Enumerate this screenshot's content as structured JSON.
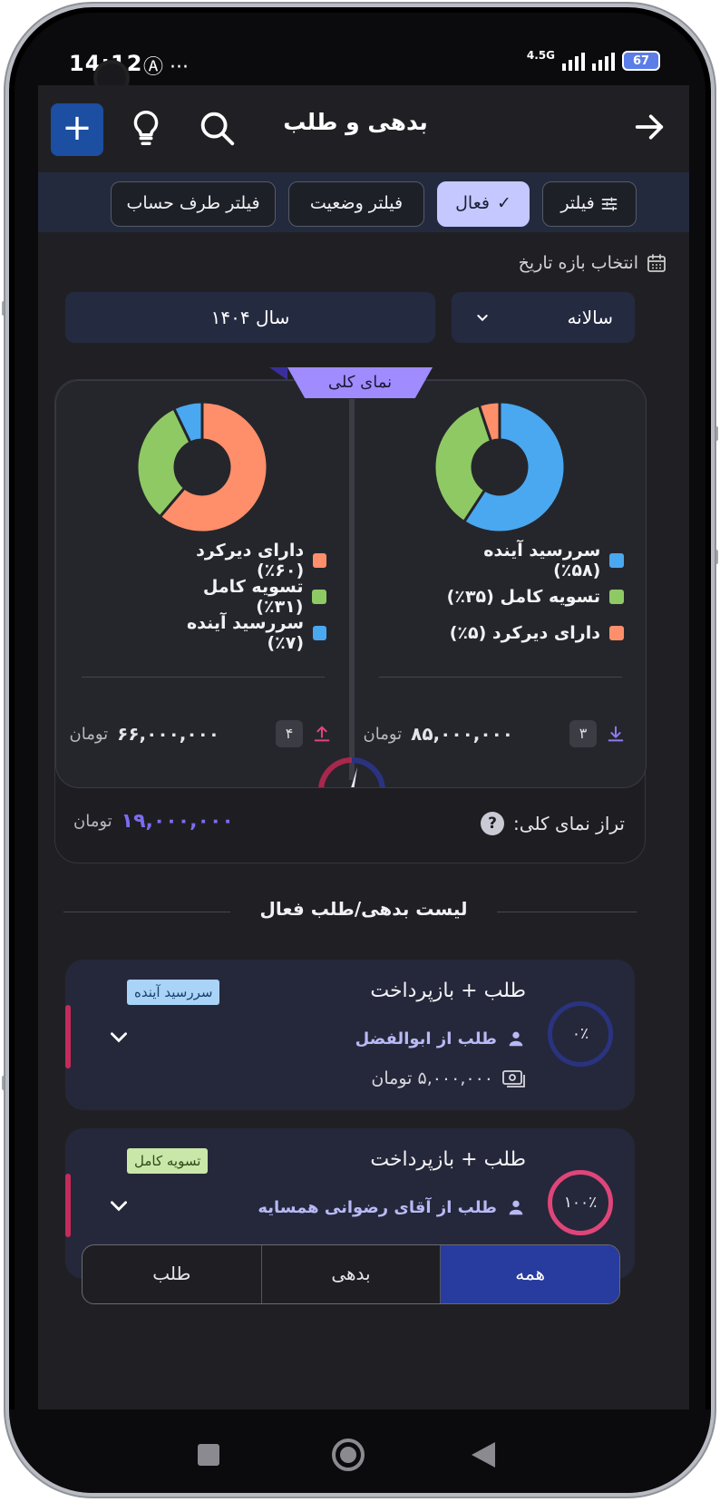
{
  "status_bar": {
    "time": "14:12",
    "network": "4.5G",
    "battery": "67"
  },
  "app_bar": {
    "title": "بدهی و طلب",
    "add_label": "+"
  },
  "filters": [
    {
      "label": "فیلتر"
    },
    {
      "label": "فعال",
      "active": true
    },
    {
      "label": "فیلتر وضعیت"
    },
    {
      "label": "فیلتر طرف حساب"
    }
  ],
  "date_range": {
    "label": "انتخاب بازه تاریخ",
    "period_value": "سالانه",
    "year_value": "سال ۱۴۰۴"
  },
  "overview": {
    "tag": "نمای کلی",
    "receivables": {
      "legend": [
        {
          "label": "سررسید آینده (۵۸٪)",
          "color": "#4aa8f0",
          "percent": 58
        },
        {
          "label": "تسویه کامل (۳۵٪)",
          "color": "#8fc964",
          "percent": 35
        },
        {
          "label": "دارای دیرکرد (۵٪)",
          "color": "#ff8f6a",
          "percent": 5
        }
      ],
      "count": "۳",
      "amount": "۸۵,۰۰۰,۰۰۰",
      "unit": "تومان"
    },
    "debts": {
      "legend": [
        {
          "label": "دارای دیرکرد (۶۰٪)",
          "color": "#ff8f6a",
          "percent": 60
        },
        {
          "label": "تسویه کامل (۳۱٪)",
          "color": "#8fc964",
          "percent": 31
        },
        {
          "label": "سررسید آینده (۷٪)",
          "color": "#4aa8f0",
          "percent": 7
        }
      ],
      "count": "۴",
      "amount": "۶۶,۰۰۰,۰۰۰",
      "unit": "تومان"
    },
    "balance_label": "تراز نمای کلی:",
    "balance_amount": "۱۹,۰۰۰,۰۰۰",
    "balance_unit": "تومان",
    "help_icon_text": "?"
  },
  "list_title": "لیست بدهی/طلب فعال",
  "items": [
    {
      "title": "طلب + بازپرداخت",
      "person": "طلب از ابوالفضل",
      "amount": "۵,۰۰۰,۰۰۰ تومان",
      "status": "سررسید آینده",
      "status_bg": "#a9d3f7",
      "status_fg": "#1a3f6e",
      "progress": "۰٪",
      "progress_value": 0,
      "ring_color": "#2a3380"
    },
    {
      "title": "طلب + بازپرداخت",
      "person": "طلب از آقای رضوانی همسایه",
      "status": "تسویه کامل",
      "status_bg": "#c9e7a8",
      "status_fg": "#2e4a1a",
      "progress": "۱۰۰٪",
      "progress_value": 100,
      "ring_color": "#e0457a"
    }
  ],
  "segments": [
    {
      "label": "همه",
      "active": true
    },
    {
      "label": "بدهی"
    },
    {
      "label": "طلب"
    }
  ]
}
